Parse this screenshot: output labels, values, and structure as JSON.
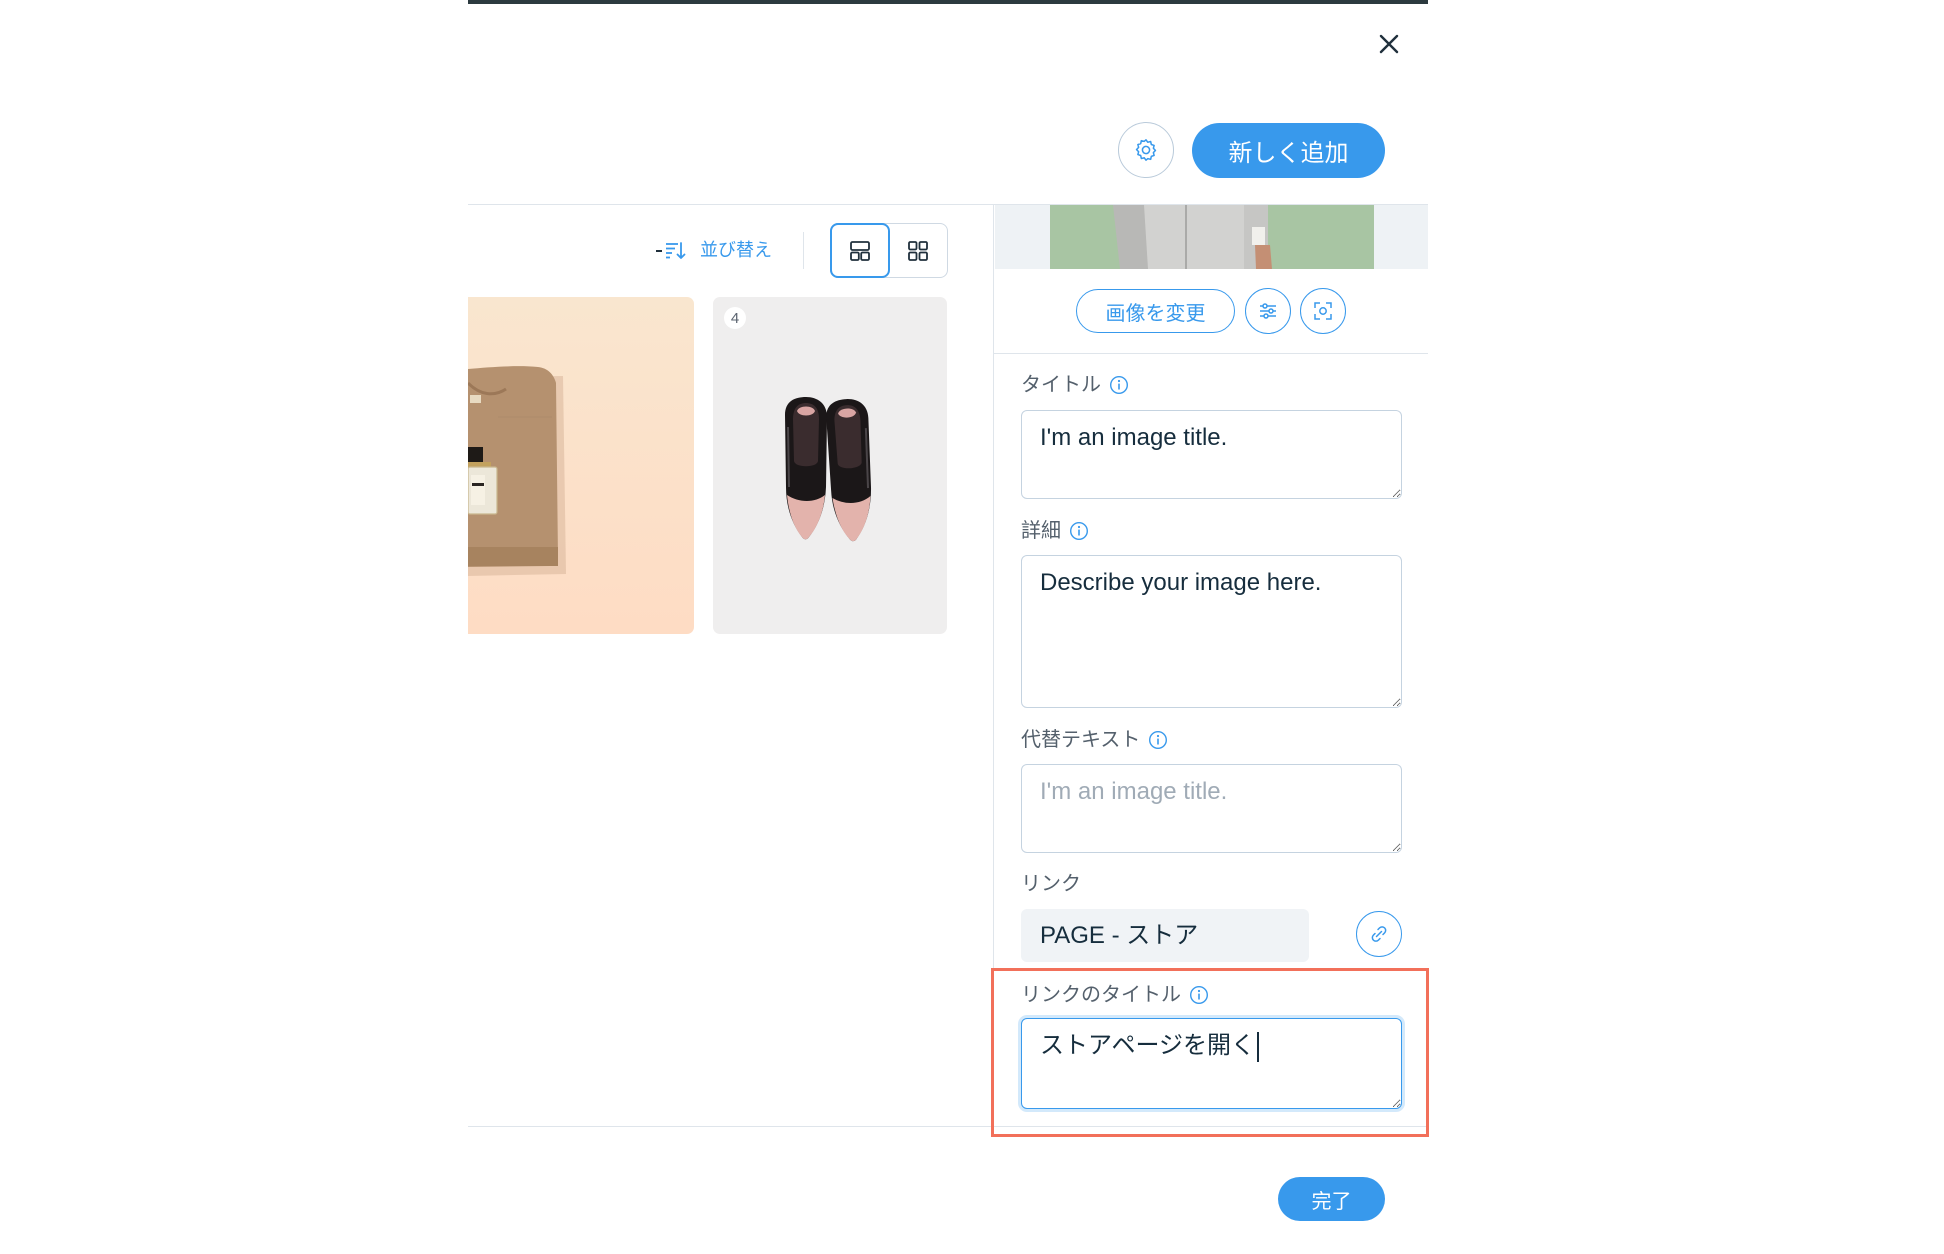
{
  "modal": {
    "close_icon": "close-icon"
  },
  "header": {
    "settings_icon": "gear-icon",
    "add_new_label": "新しく追加"
  },
  "toolbar": {
    "sort_icon": "sort-icon",
    "sort_label": "並び替え",
    "layouts": [
      {
        "icon": "large-layout-icon",
        "selected": true
      },
      {
        "icon": "grid-layout-icon",
        "selected": false
      }
    ]
  },
  "gallery": {
    "items": [
      {},
      {
        "badge": "4"
      }
    ]
  },
  "details": {
    "change_image_label": "画像を変更",
    "adjust_icon": "sliders-icon",
    "focal_point_icon": "focal-point-icon",
    "title": {
      "label": "タイトル",
      "value": "I'm an image title.",
      "info_icon": "info-icon"
    },
    "description": {
      "label": "詳細",
      "value": "Describe your image here.",
      "info_icon": "info-icon"
    },
    "alt_text": {
      "label": "代替テキスト",
      "value": "",
      "placeholder": "I'm an image title.",
      "info_icon": "info-icon"
    },
    "link": {
      "label": "リンク",
      "value": "PAGE - ストア",
      "link_icon": "link-icon"
    },
    "link_title": {
      "label": "リンクのタイトル",
      "value": "ストアページを開く",
      "info_icon": "info-icon",
      "focused": true,
      "highlighted": true
    }
  },
  "footer": {
    "done_label": "完了"
  },
  "colors": {
    "accent": "#3899ec",
    "highlight_border": "#f2705a",
    "panel_background": "#eef2f5"
  }
}
